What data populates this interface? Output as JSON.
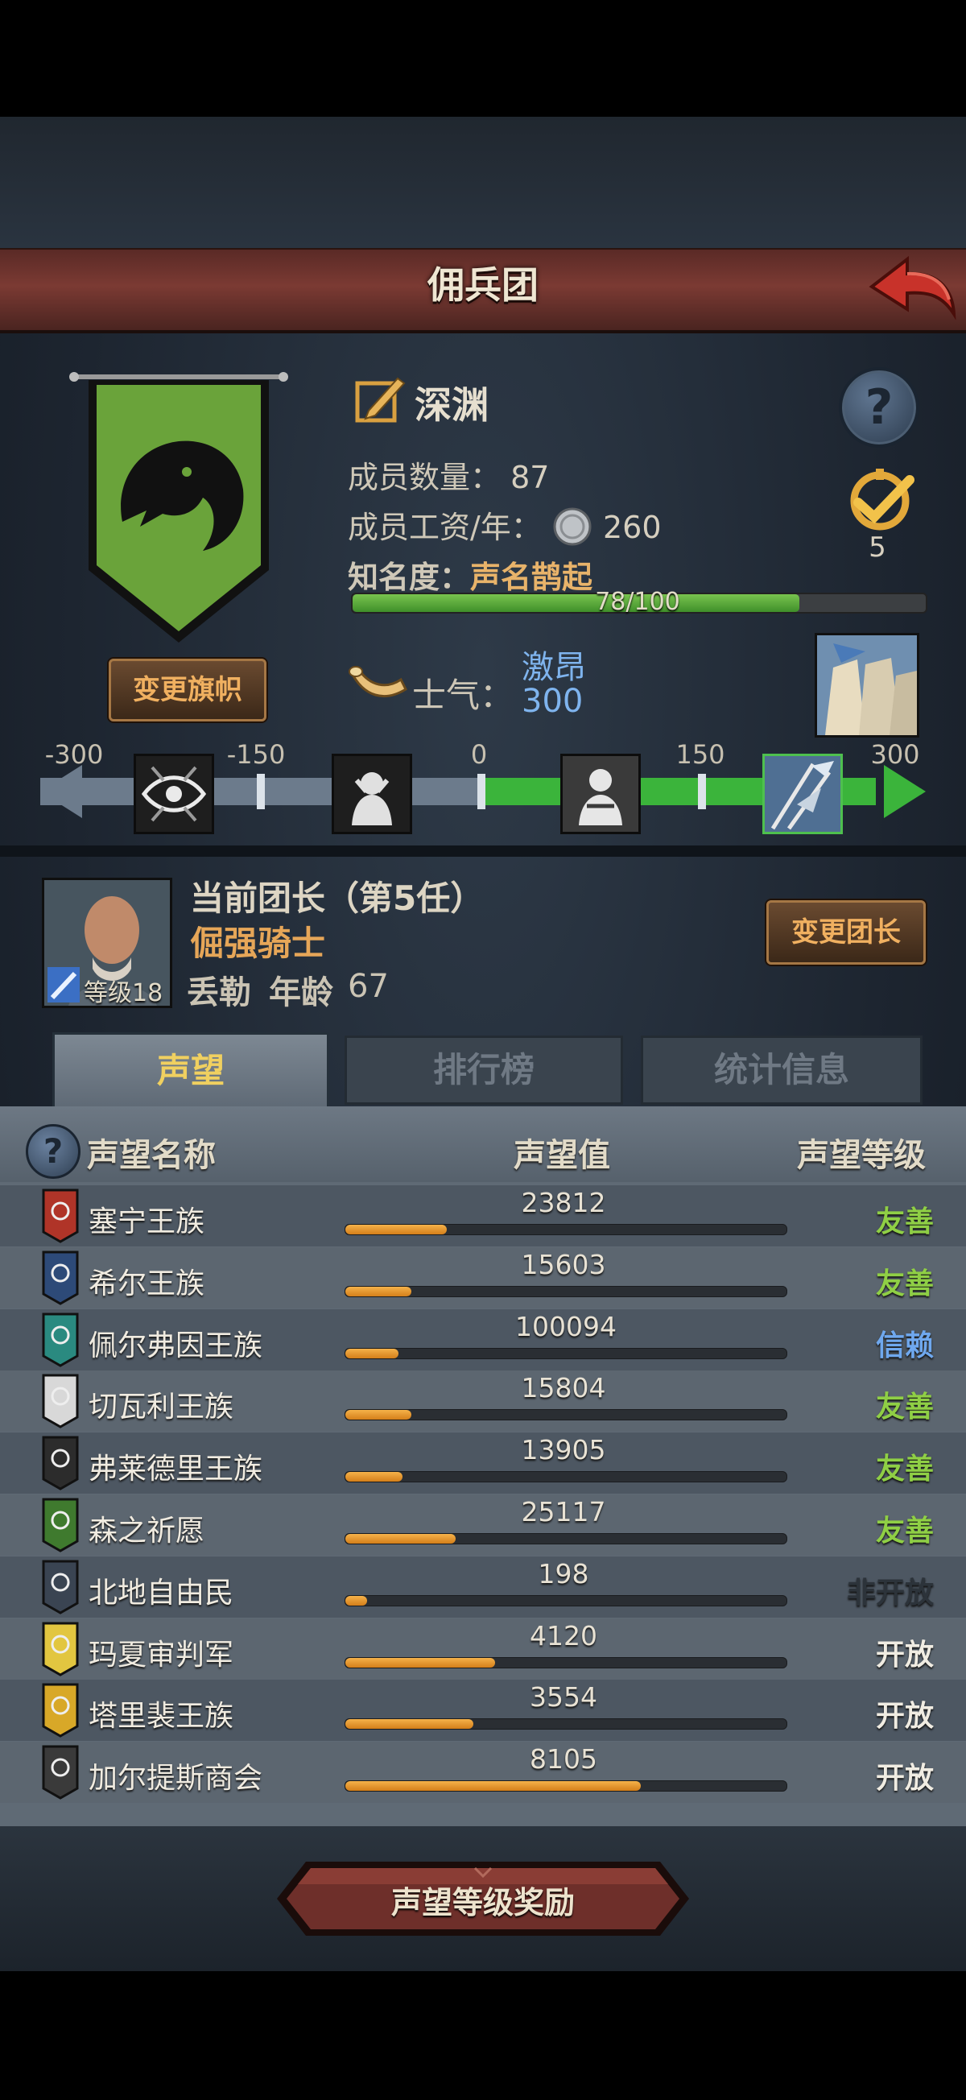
{
  "title": "佣兵团",
  "team": {
    "name": "深渊",
    "members_label": "成员数量：",
    "members_value": "87",
    "salary_label": "成员工资/年：",
    "salary_value": "260",
    "fame_label": "知名度：",
    "fame_title": "声名鹊起",
    "fame_progress_text": "78/100",
    "fame_progress": 0.78,
    "rank_number": "5",
    "change_flag_label": "变更旗帜"
  },
  "morale": {
    "label": "士气：",
    "state": "激昂",
    "value": "300",
    "ticks": [
      "-300",
      "-150",
      "0",
      "150",
      "300"
    ]
  },
  "leader": {
    "title": "当前团长（第5任）",
    "rank": "倔强骑士",
    "level": "等级18",
    "name": "丢勒",
    "age_label": "年龄",
    "age": "67",
    "change_label": "变更团长"
  },
  "tabs": [
    "声望",
    "排行榜",
    "统计信息"
  ],
  "table": {
    "headers": [
      "声望名称",
      "声望值",
      "声望等级"
    ],
    "rows": [
      {
        "name": "塞宁王族",
        "value": "23812",
        "fill": 0.23,
        "level": "友善",
        "level_color": "#8fcf45",
        "emblem_color": "#b03428"
      },
      {
        "name": "希尔王族",
        "value": "15603",
        "fill": 0.15,
        "level": "友善",
        "level_color": "#8fcf45",
        "emblem_color": "#2d4a78"
      },
      {
        "name": "佩尔弗因王族",
        "value": "100094",
        "fill": 0.12,
        "level": "信赖",
        "level_color": "#6fa8ee",
        "emblem_color": "#2a8a80"
      },
      {
        "name": "切瓦利王族",
        "value": "15804",
        "fill": 0.15,
        "level": "友善",
        "level_color": "#8fcf45",
        "emblem_color": "#d8d8d8"
      },
      {
        "name": "弗莱德里王族",
        "value": "13905",
        "fill": 0.13,
        "level": "友善",
        "level_color": "#8fcf45",
        "emblem_color": "#2c2c2c"
      },
      {
        "name": "森之祈愿",
        "value": "25117",
        "fill": 0.25,
        "level": "友善",
        "level_color": "#8fcf45",
        "emblem_color": "#3f7a2e"
      },
      {
        "name": "北地自由民",
        "value": "198",
        "fill": 0.05,
        "level": "非开放",
        "level_color": "#2c333a",
        "emblem_color": "#3a4452"
      },
      {
        "name": "玛夏审判军",
        "value": "4120",
        "fill": 0.34,
        "level": "开放",
        "level_color": "#f0ece2",
        "emblem_color": "#e2c640"
      },
      {
        "name": "塔里裴王族",
        "value": "3554",
        "fill": 0.29,
        "level": "开放",
        "level_color": "#f0ece2",
        "emblem_color": "#d8a828"
      },
      {
        "name": "加尔提斯商会",
        "value": "8105",
        "fill": 0.67,
        "level": "开放",
        "level_color": "#f0ece2",
        "emblem_color": "#3a3a3a"
      }
    ]
  },
  "reward_button": "声望等级奖励",
  "colors": {
    "banner_green": "#6aa33a",
    "title_bar": "#7b3a33",
    "accent_orange": "#f0b060",
    "morale_blue": "#7fb4ee"
  }
}
